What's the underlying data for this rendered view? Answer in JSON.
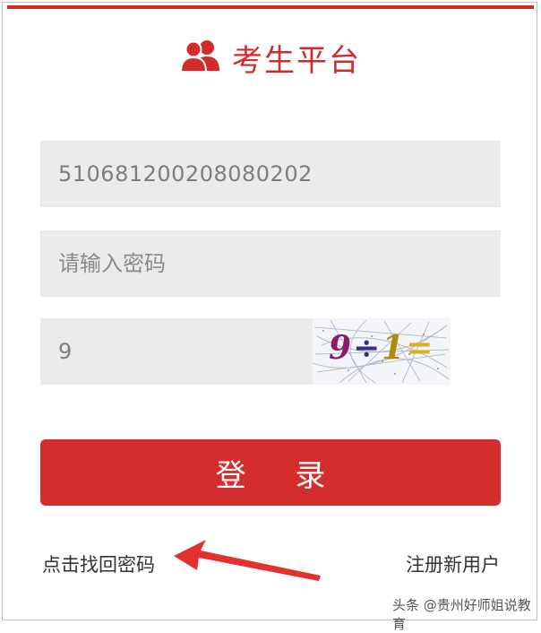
{
  "header": {
    "title": "考生平台",
    "icon": "users-icon",
    "color": "#d42a2a"
  },
  "form": {
    "account_value": "510681200208080202",
    "password_placeholder": "请输入密码",
    "captcha_value": "9",
    "captcha_image": {
      "parts": [
        "9",
        "÷",
        "1",
        "="
      ]
    }
  },
  "login_button": {
    "label": "登 录",
    "color": "#d42d2d"
  },
  "links": {
    "forgot_password": "点击找回密码",
    "register": "注册新用户"
  },
  "annotation": {
    "arrow_color": "#e53030",
    "icon": "arrow-pointer-icon"
  },
  "watermark": {
    "text": "头条 @贵州好师姐说教育"
  }
}
